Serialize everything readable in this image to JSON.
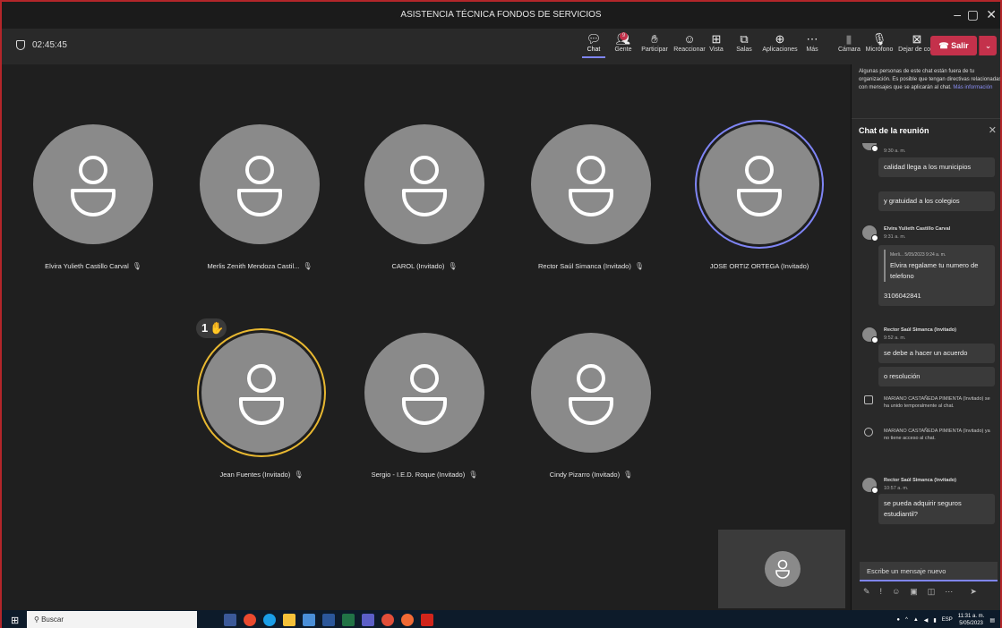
{
  "window": {
    "title": "ASISTENCIA TÉCNICA FONDOS DE SERVICIOS"
  },
  "meeting": {
    "timer": "02:45:45"
  },
  "toolbar": {
    "items": [
      {
        "label": "Chat",
        "icon": "chat-icon",
        "glyph": "☺"
      },
      {
        "label": "Gente",
        "icon": "people-icon",
        "glyph": "☻",
        "badge": "9"
      },
      {
        "label": "Participar",
        "icon": "raise-hand-icon",
        "glyph": "✋"
      },
      {
        "label": "Reaccionar",
        "icon": "reaction-icon",
        "glyph": "☺"
      },
      {
        "label": "Vista",
        "icon": "view-icon",
        "glyph": "⊞"
      },
      {
        "label": "Salas",
        "icon": "rooms-icon",
        "glyph": "⧉"
      },
      {
        "label": "Aplicaciones",
        "icon": "apps-icon",
        "glyph": "⊕"
      },
      {
        "label": "Más",
        "icon": "more-icon",
        "glyph": "⋯"
      },
      {
        "label": "Cámara",
        "icon": "camera-off-icon",
        "glyph": "▮"
      },
      {
        "label": "Micrófono",
        "icon": "mic-icon",
        "glyph": "🎙"
      },
      {
        "label": "Dejar de co...",
        "icon": "stop-share-icon",
        "glyph": "✖"
      }
    ],
    "leave_label": "Salir"
  },
  "participants": [
    {
      "name": "Elvira Yulieth Castillo Carval"
    },
    {
      "name": "Merlis Zenith Mendoza Castil..."
    },
    {
      "name": "CAROL (Invitado)"
    },
    {
      "name": "Rector Saúl Simanca (Invitado)"
    },
    {
      "name": "JOSE ORTIZ ORTEGA (Invitado)"
    },
    {
      "name": "Jean Fuentes (Invitado)",
      "hand_order": "1"
    },
    {
      "name": "Sergio - I.E.D. Roque (Invitado)"
    },
    {
      "name": "Cindy Pizarro (Invitado)"
    }
  ],
  "chat": {
    "notice": "Algunas personas de este chat están fuera de tu organización. Es posible que tengan directivas relacionadas con mensajes que se aplicarán al chat.",
    "notice_link": "Más información",
    "title": "Chat de la reunión",
    "messages": {
      "m1_time": "9:30 a. m.",
      "m1_b1": "calidad llega a los municipios",
      "m1_b2": "y gratuidad a los colegios",
      "m2_sender": "Elvira Yulieth Castillo Carval",
      "m2_time": "9:31 a. m.",
      "m2_quote_meta": "Merli... 5/05/2023 9:24 a. m.",
      "m2_quote_text": "Elvira regalame tu numero de telefono",
      "m2_b1": "3106042841",
      "m3_sender": "Rector Saúl Simanca (Invitado)",
      "m3_time": "9:52 a. m.",
      "m3_b1": "se debe a hacer un acuerdo",
      "m3_b2": "o resolución",
      "sys1": "MARIANO CASTAÑEDA PIMIENTA (Invitado) se ha unido temporalmente al chat.",
      "sys2": "MARIANO CASTAÑEDA PIMIENTA (Invitado) ya no tiene acceso al chat.",
      "m4_sender": "Rector Saúl Simanca (Invitado)",
      "m4_time": "10:57 a. m.",
      "m4_b1": "se pueda adquirir seguros estudiantil?"
    },
    "compose_placeholder": "Escribe un mensaje nuevo"
  },
  "taskbar": {
    "search_placeholder": "Buscar",
    "lang": "ESP",
    "time": "11:31 a. m.",
    "date": "5/05/2023"
  }
}
